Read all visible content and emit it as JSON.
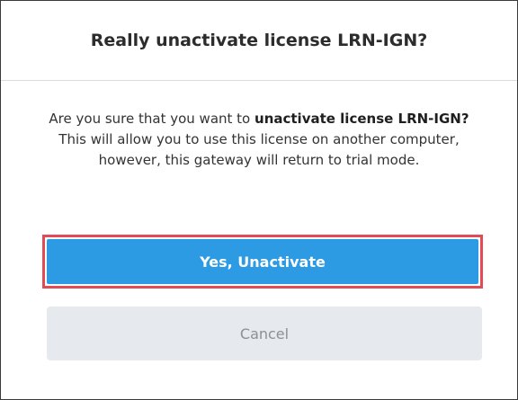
{
  "dialog": {
    "title": "Really unactivate license LRN-IGN?",
    "message": {
      "part1": "Are you sure that you want to ",
      "bold1": "unactivate license LRN-IGN?",
      "part2": " This will allow you to use this license on another computer, however, this gateway will return to trial mode."
    },
    "confirm_label": "Yes, Unactivate",
    "cancel_label": "Cancel"
  },
  "colors": {
    "confirm_bg": "#2d9ae4",
    "highlight_border": "#e24b55",
    "cancel_bg": "#e6e9ed",
    "cancel_text": "#8a9097"
  }
}
